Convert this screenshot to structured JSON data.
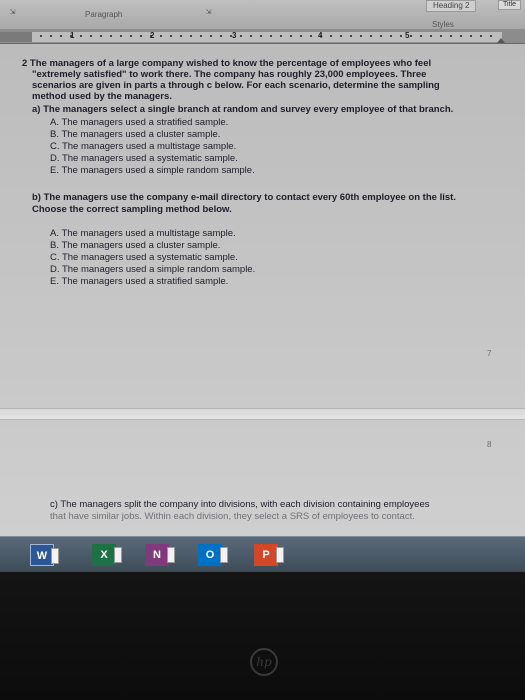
{
  "ribbon": {
    "paragraph_label": "Paragraph",
    "styles_label": "Styles",
    "style_chip": "Heading 2",
    "title_chip": "Title"
  },
  "ruler": {
    "numbers": [
      "1",
      "2",
      "3",
      "4",
      "5"
    ]
  },
  "document": {
    "q2_lines": [
      "2  The managers of a large company wished to know the percentage of employees who feel",
      "\"extremely satisfied\" to work there. The company has roughly 23,000 employees. Three",
      "scenarios are given in parts a through c below. For each scenario, determine the sampling",
      "method used by the managers."
    ],
    "part_a": {
      "prompt": "a) The managers select a single branch at random and survey every employee of that branch.",
      "options": [
        "A. The managers used a stratified sample.",
        "B. The managers used a cluster sample.",
        "C. The managers used a multistage sample.",
        "D. The managers used a systematic sample.",
        "E. The managers used a simple random sample."
      ]
    },
    "part_b": {
      "prompt_lines": [
        "b) The managers use the company e-mail directory to contact every 60th employee on the list.",
        "Choose the correct sampling method below."
      ],
      "options": [
        "A. The managers used a multistage sample.",
        "B. The managers used a cluster sample.",
        "C. The managers used a systematic sample.",
        "D. The managers used a simple random sample.",
        "E. The managers used a stratified sample."
      ]
    },
    "part_c": {
      "lines": [
        "c) The managers split the company into divisions, with each division containing employees",
        "that have similar jobs. Within each division, they select a SRS of employees to contact."
      ]
    },
    "page_numbers": [
      "7",
      "8"
    ]
  },
  "taskbar": {
    "apps": [
      {
        "letter": "W",
        "name": "Word",
        "color": "#2b5797"
      },
      {
        "letter": "X",
        "name": "Excel",
        "color": "#1e7145"
      },
      {
        "letter": "N",
        "name": "OneNote",
        "color": "#80397b"
      },
      {
        "letter": "O",
        "name": "Outlook",
        "color": "#0072c6"
      },
      {
        "letter": "P",
        "name": "PowerPoint",
        "color": "#d24726"
      }
    ]
  },
  "bezel": {
    "logo": "hp"
  }
}
